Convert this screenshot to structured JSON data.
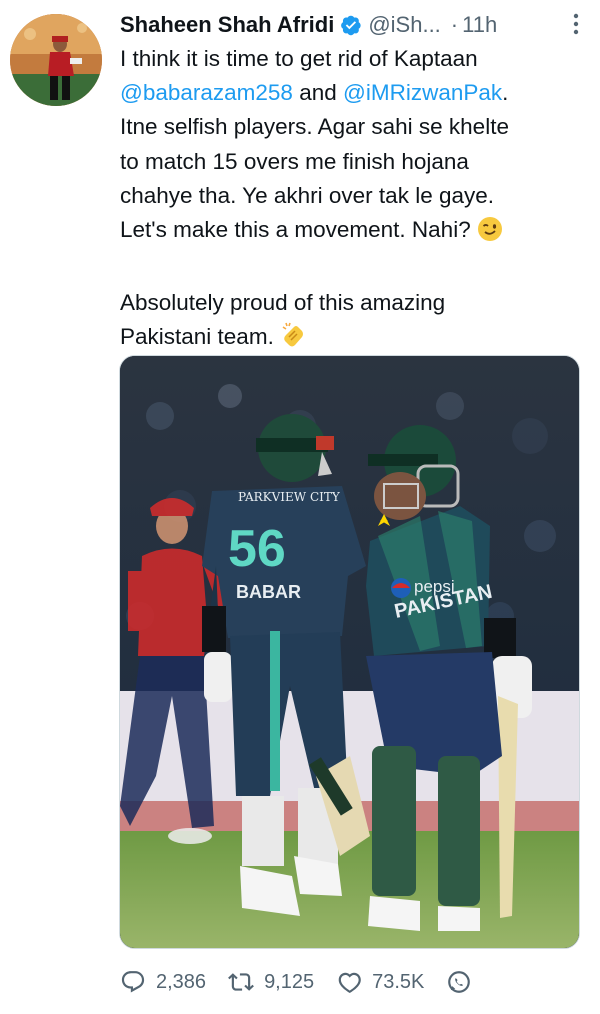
{
  "tweet": {
    "author_name": "Shaheen Shah Afridi",
    "handle": "@iSh...",
    "separator": "·",
    "time": "11h",
    "text": {
      "l1": "I think it is time to get rid of Kaptaan",
      "mention1": "@babarazam258",
      "and": " and ",
      "mention2": "@iMRizwanPak",
      "period": ".",
      "l3": "Itne selfish players. Agar sahi se khelte",
      "l4": "to match 15 overs me finish hojana",
      "l5": "chahye tha. Ye akhri over tak le gaye.",
      "l6": "Let's make this a movement. Nahi?",
      "l7": "Absolutely proud of this amazing",
      "l8": "Pakistani team."
    }
  },
  "media": {
    "jersey_sponsor_left": "PARKVIEW CITY",
    "jersey_number": "56",
    "jersey_name": "BABAR",
    "jersey_sponsor_right": "pepsi",
    "jersey_country": "PAKISTAN"
  },
  "actions": {
    "replies": "2,386",
    "retweets": "9,125",
    "likes": "73.5K"
  },
  "colors": {
    "link": "#1d9bf0",
    "secondary_text": "#536471",
    "verified": "#1d9bf0",
    "pakistan_kit": "#1f3a4a",
    "england_kit": "#d52b2b"
  },
  "icons": [
    "verified-badge-icon",
    "more-options-icon",
    "wink-emoji-icon",
    "clapping-hands-emoji-icon",
    "reply-icon",
    "retweet-icon",
    "like-icon",
    "share-icon"
  ]
}
